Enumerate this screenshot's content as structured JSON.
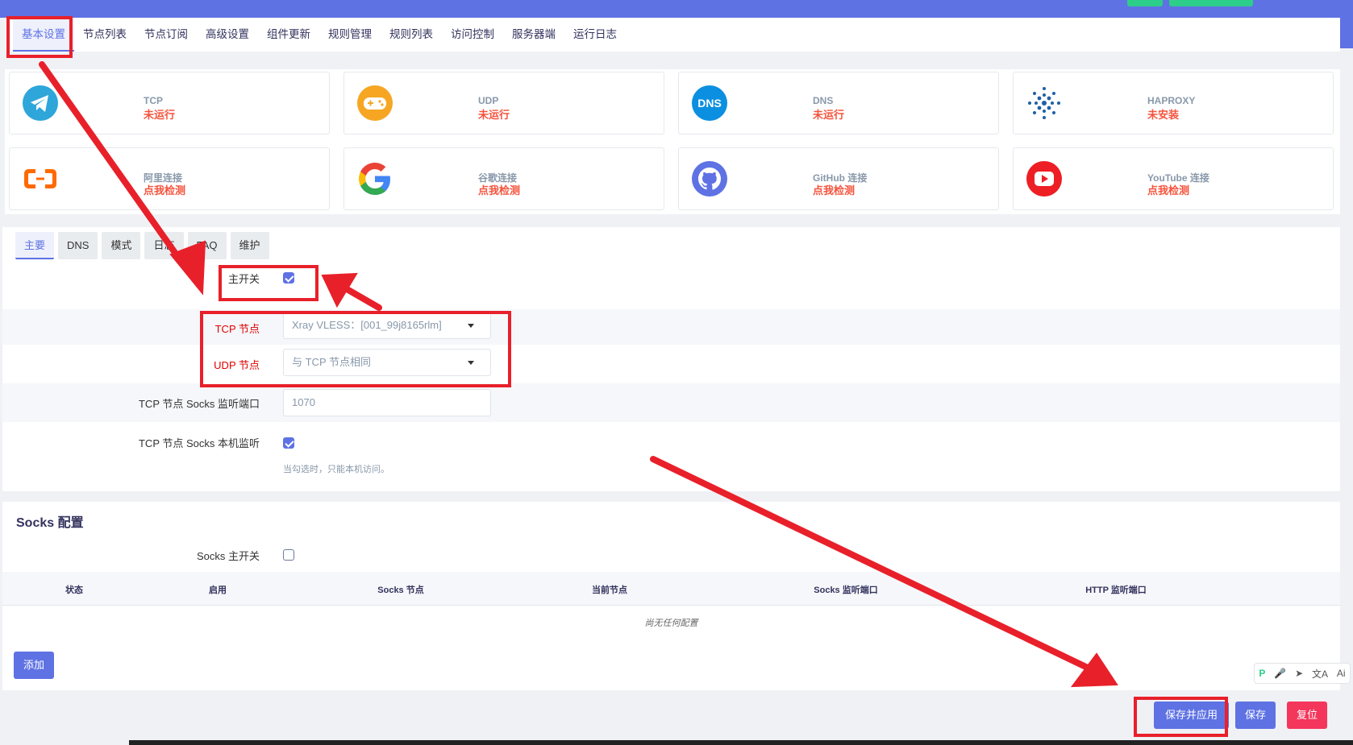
{
  "nav_tabs": [
    {
      "label": "基本设置",
      "active": true
    },
    {
      "label": "节点列表"
    },
    {
      "label": "节点订阅"
    },
    {
      "label": "高级设置"
    },
    {
      "label": "组件更新"
    },
    {
      "label": "规则管理"
    },
    {
      "label": "规则列表"
    },
    {
      "label": "访问控制"
    },
    {
      "label": "服务器端"
    },
    {
      "label": "运行日志"
    }
  ],
  "status_cards": [
    {
      "name": "TCP",
      "status": "未运行",
      "icon": "telegram-icon"
    },
    {
      "name": "UDP",
      "status": "未运行",
      "icon": "gamepad-icon"
    },
    {
      "name": "DNS",
      "status": "未运行",
      "icon": "dns-icon",
      "icon_text": "DNS"
    },
    {
      "name": "HAPROXY",
      "status": "未安装",
      "icon": "haproxy-icon"
    },
    {
      "name": "阿里连接",
      "status": "点我检测",
      "icon": "aliyun-icon"
    },
    {
      "name": "谷歌连接",
      "status": "点我检测",
      "icon": "google-icon"
    },
    {
      "name": "GitHub 连接",
      "status": "点我检测",
      "icon": "github-icon"
    },
    {
      "name": "YouTube 连接",
      "status": "点我检测",
      "icon": "youtube-icon"
    }
  ],
  "sub_tabs": [
    {
      "label": "主要",
      "active": true
    },
    {
      "label": "DNS"
    },
    {
      "label": "模式"
    },
    {
      "label": "日志"
    },
    {
      "label": "FAQ"
    },
    {
      "label": "维护"
    }
  ],
  "form": {
    "main_switch_label": "主开关",
    "main_switch_checked": true,
    "tcp_node_label": "TCP 节点",
    "tcp_node_value": "Xray VLESS：[001_99j8165rlm]",
    "udp_node_label": "UDP 节点",
    "udp_node_value": "与 TCP 节点相同",
    "socks_port_label": "TCP 节点 Socks 监听端口",
    "socks_port_value": "1070",
    "socks_local_label": "TCP 节点 Socks 本机监听",
    "socks_local_checked": true,
    "socks_local_hint": "当勾选时，只能本机访问。"
  },
  "socks": {
    "title": "Socks 配置",
    "switch_label": "Socks 主开关",
    "switch_checked": false,
    "columns": [
      "状态",
      "启用",
      "Socks 节点",
      "当前节点",
      "Socks 监听端口",
      "HTTP 监听端口"
    ],
    "empty_text": "尚无任何配置",
    "add_label": "添加"
  },
  "actions": {
    "save_apply_label": "保存并应用",
    "save_label": "保存",
    "reset_label": "复位"
  },
  "mini_toolbar": [
    "P",
    "🎤",
    "➤",
    "文A",
    "Ai"
  ],
  "colors": {
    "accent": "#5e72e4",
    "danger": "#f5365c",
    "status_red": "#f5533d",
    "annotation_red": "#e8202a"
  }
}
